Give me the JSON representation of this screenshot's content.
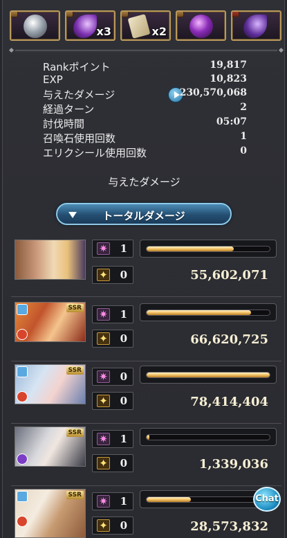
{
  "rewards": [
    {
      "item": "silver-orb-icon",
      "count": ""
    },
    {
      "item": "crescent-gem-icon",
      "count": "x3"
    },
    {
      "item": "paper-scroll-icon",
      "count": "x2"
    },
    {
      "item": "dark-orb-icon",
      "count": ""
    },
    {
      "item": "crescent-gem-icon",
      "count": ""
    }
  ],
  "stats": [
    {
      "label": "Rankポイント",
      "value": "19,817"
    },
    {
      "label": "EXP",
      "value": "10,823"
    },
    {
      "label": "与えたダメージ",
      "value": "230,570,068"
    },
    {
      "label": "経過ターン",
      "value": "2"
    },
    {
      "label": "討伐時間",
      "value": "05:07"
    },
    {
      "label": "召喚石使用回数",
      "value": "1"
    },
    {
      "label": "エリクシール使用回数",
      "value": "0"
    }
  ],
  "section_title": "与えたダメージ",
  "total_button": "トータルダメージ",
  "characters": [
    {
      "skills": "1",
      "charge_attacks": "0",
      "bar_fraction": 0.71,
      "damage": "55,602,071",
      "attr": "",
      "ssr": ""
    },
    {
      "skills": "1",
      "charge_attacks": "0",
      "bar_fraction": 0.85,
      "damage": "66,620,725",
      "attr": "fire",
      "ssr": "SSR"
    },
    {
      "skills": "0",
      "charge_attacks": "0",
      "bar_fraction": 1.0,
      "damage": "78,414,404",
      "attr": "fire",
      "ssr": "SSR"
    },
    {
      "skills": "1",
      "charge_attacks": "0",
      "bar_fraction": 0.02,
      "damage": "1,339,036",
      "attr": "dark",
      "ssr": "SSR"
    },
    {
      "skills": "1",
      "charge_attacks": "0",
      "bar_fraction": 0.36,
      "damage": "28,573,832",
      "attr": "fire",
      "ssr": "SSR"
    }
  ],
  "chat_label": "Chat"
}
